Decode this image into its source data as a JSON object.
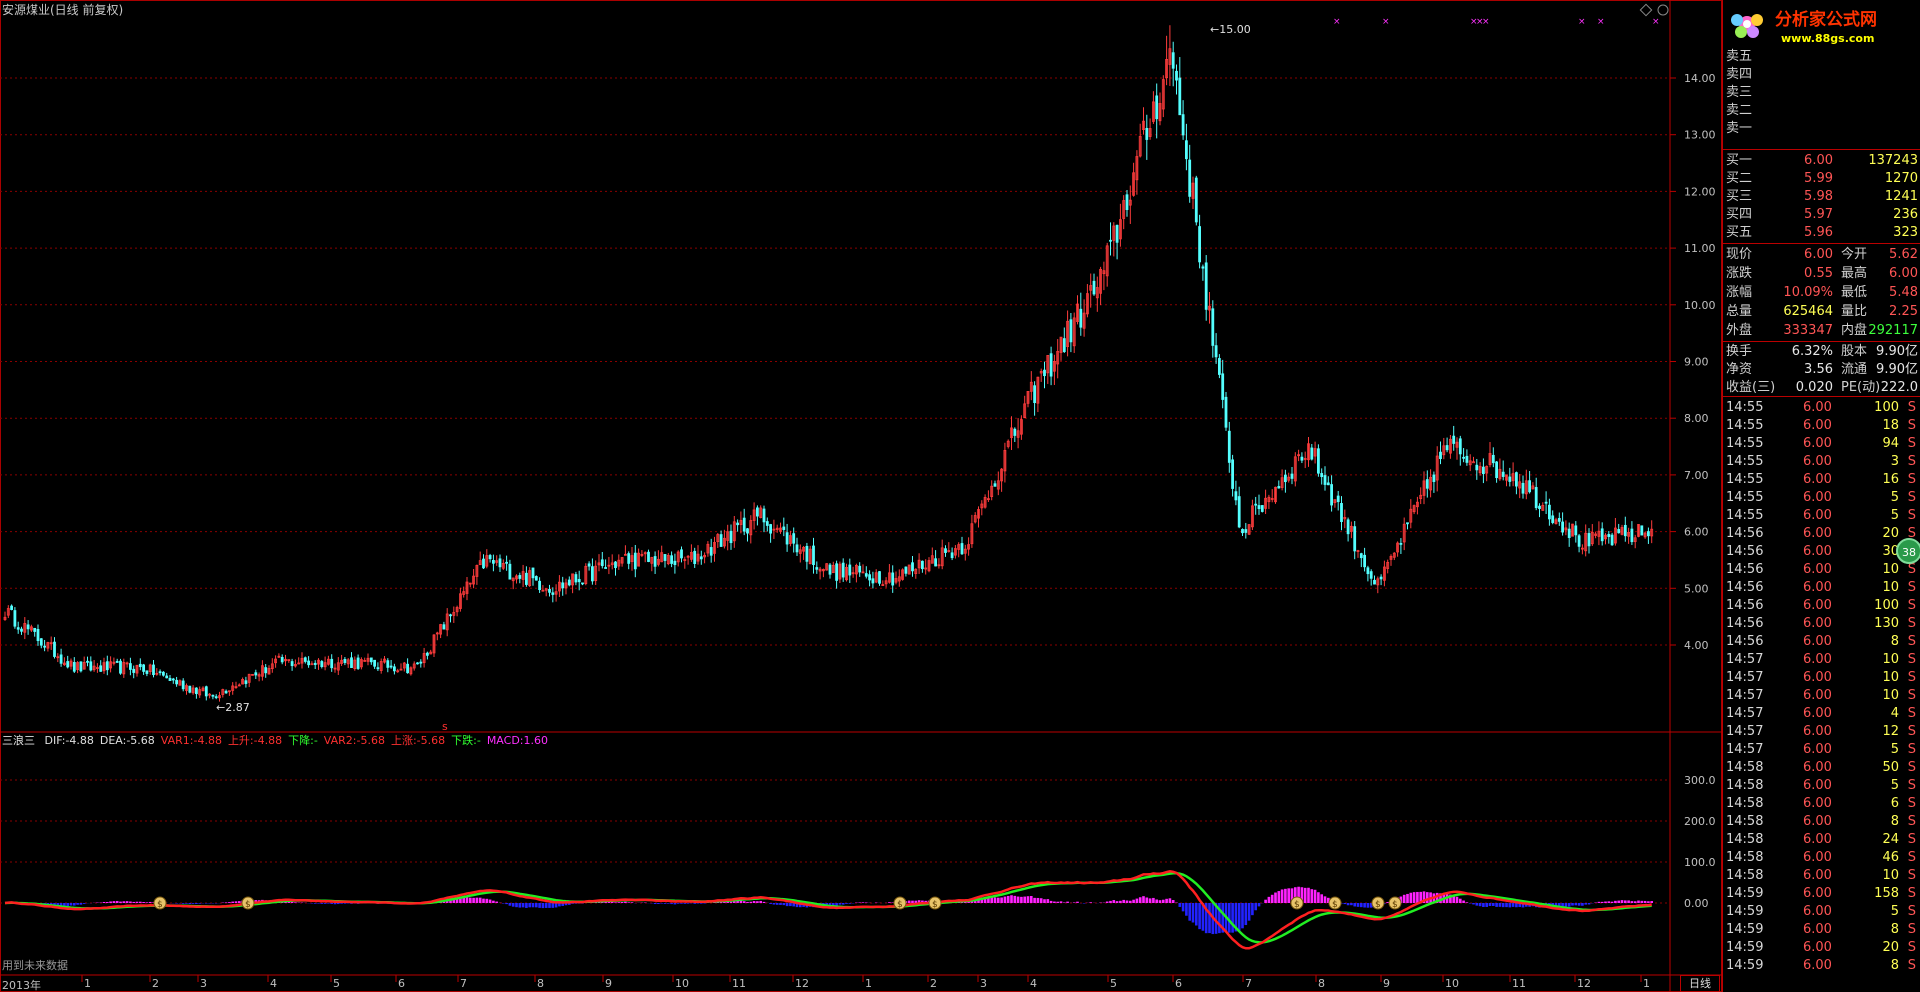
{
  "window": {
    "title": "安源煤业(日线 前复权)",
    "status_text": "用到未来数据",
    "period_button": "日线",
    "badge": "38"
  },
  "logo": {
    "brand": "分析家公式网",
    "url": "www.88gs.com"
  },
  "price_axis": [
    "14.00",
    "13.00",
    "12.00",
    "11.00",
    "10.00",
    "9.00",
    "8.00",
    "7.00",
    "6.00",
    "5.00",
    "4.00"
  ],
  "indicator_axis": [
    "300.0",
    "200.0",
    "100.0",
    "0.00"
  ],
  "price_annotations": {
    "high": "15.00",
    "low": "2.87",
    "marker": "s"
  },
  "x_labels": [
    "2013年",
    "1",
    "2",
    "3",
    "4",
    "5",
    "6",
    "7",
    "8",
    "9",
    "10",
    "11",
    "12",
    "1",
    "2",
    "3",
    "4",
    "5",
    "6",
    "7",
    "8",
    "9",
    "10",
    "11",
    "12",
    "1"
  ],
  "indicator": {
    "name": "三浪三",
    "items": [
      {
        "label": "DIF:",
        "value": "-4.88",
        "color": "#e0e0e0"
      },
      {
        "label": "DEA:",
        "value": "-5.68",
        "color": "#e0e0e0"
      },
      {
        "label": "VAR1:",
        "value": "-4.88",
        "color": "#ff3030"
      },
      {
        "label": "上升:",
        "value": "-4.88",
        "color": "#ff3030"
      },
      {
        "label": "下降:",
        "value": "-",
        "color": "#30ff30"
      },
      {
        "label": "VAR2:",
        "value": "-5.68",
        "color": "#ff3030"
      },
      {
        "label": "上涨:",
        "value": "-5.68",
        "color": "#ff3030"
      },
      {
        "label": "下跌:",
        "value": "-",
        "color": "#30ff30"
      },
      {
        "label": "MACD:",
        "value": "1.60",
        "color": "#ff30ff"
      }
    ]
  },
  "order_book": {
    "asks": [
      {
        "label": "卖五",
        "price": "",
        "vol": ""
      },
      {
        "label": "卖四",
        "price": "",
        "vol": ""
      },
      {
        "label": "卖三",
        "price": "",
        "vol": ""
      },
      {
        "label": "卖二",
        "price": "",
        "vol": ""
      },
      {
        "label": "卖一",
        "price": "",
        "vol": ""
      }
    ],
    "bids": [
      {
        "label": "买一",
        "price": "6.00",
        "vol": "137243"
      },
      {
        "label": "买二",
        "price": "5.99",
        "vol": "1270"
      },
      {
        "label": "买三",
        "price": "5.98",
        "vol": "1241"
      },
      {
        "label": "买四",
        "price": "5.97",
        "vol": "236"
      },
      {
        "label": "买五",
        "price": "5.96",
        "vol": "323"
      }
    ]
  },
  "quote": [
    {
      "l1": "现价",
      "v1": "6.00",
      "c1": "red",
      "l2": "今开",
      "v2": "5.62",
      "c2": "red"
    },
    {
      "l1": "涨跌",
      "v1": "0.55",
      "c1": "red",
      "l2": "最高",
      "v2": "6.00",
      "c2": "red"
    },
    {
      "l1": "涨幅",
      "v1": "10.09%",
      "c1": "red",
      "l2": "最低",
      "v2": "5.48",
      "c2": "red"
    },
    {
      "l1": "总量",
      "v1": "625464",
      "c1": "yellow",
      "l2": "量比",
      "v2": "2.25",
      "c2": "red"
    },
    {
      "l1": "外盘",
      "v1": "333347",
      "c1": "red",
      "l2": "内盘",
      "v2": "292117",
      "c2": "green"
    }
  ],
  "fundamentals": [
    {
      "l1": "换手",
      "v1": "6.32%",
      "l2": "股本",
      "v2": "9.90亿"
    },
    {
      "l1": "净资",
      "v1": "3.56",
      "l2": "流通",
      "v2": "9.90亿"
    },
    {
      "l1": "收益(三)",
      "v1": "0.020",
      "l2": "PE(动)",
      "v2": "222.0"
    }
  ],
  "ticks": [
    {
      "t": "14:55",
      "p": "6.00",
      "v": "100",
      "f": "S"
    },
    {
      "t": "14:55",
      "p": "6.00",
      "v": "18",
      "f": "S"
    },
    {
      "t": "14:55",
      "p": "6.00",
      "v": "94",
      "f": "S"
    },
    {
      "t": "14:55",
      "p": "6.00",
      "v": "3",
      "f": "S"
    },
    {
      "t": "14:55",
      "p": "6.00",
      "v": "16",
      "f": "S"
    },
    {
      "t": "14:55",
      "p": "6.00",
      "v": "5",
      "f": "S"
    },
    {
      "t": "14:55",
      "p": "6.00",
      "v": "5",
      "f": "S"
    },
    {
      "t": "14:56",
      "p": "6.00",
      "v": "20",
      "f": "S"
    },
    {
      "t": "14:56",
      "p": "6.00",
      "v": "30",
      "f": "S"
    },
    {
      "t": "14:56",
      "p": "6.00",
      "v": "10",
      "f": "S"
    },
    {
      "t": "14:56",
      "p": "6.00",
      "v": "10",
      "f": "S"
    },
    {
      "t": "14:56",
      "p": "6.00",
      "v": "100",
      "f": "S"
    },
    {
      "t": "14:56",
      "p": "6.00",
      "v": "130",
      "f": "S"
    },
    {
      "t": "14:56",
      "p": "6.00",
      "v": "8",
      "f": "S"
    },
    {
      "t": "14:57",
      "p": "6.00",
      "v": "10",
      "f": "S"
    },
    {
      "t": "14:57",
      "p": "6.00",
      "v": "10",
      "f": "S"
    },
    {
      "t": "14:57",
      "p": "6.00",
      "v": "10",
      "f": "S"
    },
    {
      "t": "14:57",
      "p": "6.00",
      "v": "4",
      "f": "S"
    },
    {
      "t": "14:57",
      "p": "6.00",
      "v": "12",
      "f": "S"
    },
    {
      "t": "14:57",
      "p": "6.00",
      "v": "5",
      "f": "S"
    },
    {
      "t": "14:58",
      "p": "6.00",
      "v": "50",
      "f": "S"
    },
    {
      "t": "14:58",
      "p": "6.00",
      "v": "5",
      "f": "S"
    },
    {
      "t": "14:58",
      "p": "6.00",
      "v": "6",
      "f": "S"
    },
    {
      "t": "14:58",
      "p": "6.00",
      "v": "8",
      "f": "S"
    },
    {
      "t": "14:58",
      "p": "6.00",
      "v": "24",
      "f": "S"
    },
    {
      "t": "14:58",
      "p": "6.00",
      "v": "46",
      "f": "S"
    },
    {
      "t": "14:58",
      "p": "6.00",
      "v": "10",
      "f": "S"
    },
    {
      "t": "14:59",
      "p": "6.00",
      "v": "158",
      "f": "S"
    },
    {
      "t": "14:59",
      "p": "6.00",
      "v": "5",
      "f": "S"
    },
    {
      "t": "14:59",
      "p": "6.00",
      "v": "8",
      "f": "S"
    },
    {
      "t": "14:59",
      "p": "6.00",
      "v": "20",
      "f": "S"
    },
    {
      "t": "14:59",
      "p": "6.00",
      "v": "8",
      "f": "S"
    }
  ],
  "colors": {
    "up": "#ff3c3c",
    "down": "#54ffff",
    "grid": "#8a0000",
    "dif": "#ff2020",
    "dea": "#22ee22",
    "hist_pos": "#ff22ff",
    "hist_neg": "#2222ff"
  },
  "chart_data": {
    "type": "candlestick",
    "price_ylim": [
      2.5,
      15.0
    ],
    "trend_points": [
      {
        "x": "2013-01",
        "y": 4.6
      },
      {
        "x": "2013-02",
        "y": 3.6
      },
      {
        "x": "2013-03",
        "y": 3.6
      },
      {
        "x": "2013-04",
        "y": 3.1
      },
      {
        "x": "2013-05",
        "y": 3.7
      },
      {
        "x": "2013-06",
        "y": 3.7
      },
      {
        "x": "2013-07",
        "y": 3.6
      },
      {
        "x": "2013-08",
        "y": 5.5
      },
      {
        "x": "2013-09",
        "y": 5.0
      },
      {
        "x": "2013-10",
        "y": 5.5
      },
      {
        "x": "2013-11",
        "y": 5.5
      },
      {
        "x": "2013-12",
        "y": 6.3
      },
      {
        "x": "2014-01",
        "y": 5.3
      },
      {
        "x": "2014-02",
        "y": 5.2
      },
      {
        "x": "2014-03",
        "y": 5.8
      },
      {
        "x": "2014-04",
        "y": 8.5
      },
      {
        "x": "2014-05",
        "y": 10.5
      },
      {
        "x": "2014-06",
        "y": 14.5
      },
      {
        "x": "2014-07",
        "y": 6.0
      },
      {
        "x": "2014-08",
        "y": 7.5
      },
      {
        "x": "2014-09",
        "y": 5.0
      },
      {
        "x": "2014-10",
        "y": 7.5
      },
      {
        "x": "2014-11",
        "y": 7.0
      },
      {
        "x": "2014-12",
        "y": 5.8
      },
      {
        "x": "2015-01",
        "y": 6.0
      }
    ]
  }
}
